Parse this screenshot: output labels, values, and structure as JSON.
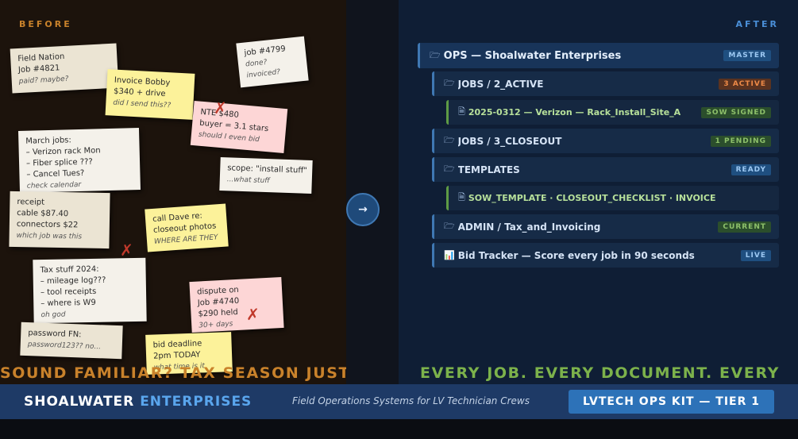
{
  "left": {
    "label": "BEFORE",
    "headline": "SOUND FAMILIAR? TAX SEASON JUST",
    "notes": [
      {
        "lines": [
          "Field Nation",
          "Job #4821"
        ],
        "italic": "paid? maybe?"
      },
      {
        "lines": [
          "Invoice Bobby",
          "$340 + drive"
        ],
        "italic": "did I send this??"
      },
      {
        "lines": [
          "job #4799",
          "done?",
          "invoiced?"
        ],
        "italic": ""
      },
      {
        "lines": [
          "NTE $480",
          "buyer = 3.1 stars"
        ],
        "italic": "should I even bid"
      },
      {
        "lines": [
          "March jobs:",
          "– Verizon rack Mon",
          "– Fiber splice ???",
          "– Cancel Tues?"
        ],
        "italic": "check calendar"
      },
      {
        "lines": [
          "scope: \"install stuff\""
        ],
        "italic": "...what stuff"
      },
      {
        "lines": [
          "receipt",
          "cable $87.40",
          "connectors $22"
        ],
        "italic": "which job was this"
      },
      {
        "lines": [
          "call Dave re:",
          "closeout photos"
        ],
        "italic": "WHERE ARE THEY"
      },
      {
        "lines": [
          "Tax stuff 2024:",
          "– mileage log???",
          "– tool receipts",
          "– where is W9"
        ],
        "italic": "oh god"
      },
      {
        "lines": [
          "dispute on",
          "Job #4740",
          "$290 held"
        ],
        "italic": "30+ days"
      },
      {
        "lines": [
          "password FN:"
        ],
        "italic": "password123?? no..."
      },
      {
        "lines": [
          "bid deadline",
          "2pm TODAY"
        ],
        "italic": "what time is it"
      }
    ],
    "x_mark": "✗"
  },
  "arrow": "→",
  "right": {
    "label": "AFTER",
    "headline": "EVERY JOB. EVERY DOCUMENT. EVERY",
    "rows": [
      {
        "icon": "🗁",
        "label": "OPS — Shoalwater Enterprises",
        "badge": "MASTER"
      },
      {
        "icon": "🗁",
        "label": "JOBS / 2_ACTIVE",
        "badge": "3 ACTIVE"
      },
      {
        "icon": "🗎",
        "label": "2025-0312 — Verizon — Rack_Install_Site_A",
        "badge": "SOW SIGNED"
      },
      {
        "icon": "🗁",
        "label": "JOBS / 3_CLOSEOUT",
        "badge": "1 PENDING"
      },
      {
        "icon": "🗁",
        "label": "TEMPLATES",
        "badge": "READY"
      },
      {
        "icon": "🗎",
        "label": "SOW_TEMPLATE · CLOSEOUT_CHECKLIST · INVOICE",
        "badge": ""
      },
      {
        "icon": "🗁",
        "label": "ADMIN / Tax_and_Invoicing",
        "badge": "CURRENT"
      },
      {
        "icon": "📊",
        "label": "Bid Tracker — Score every job in 90 seconds",
        "badge": "LIVE"
      }
    ]
  },
  "footer": {
    "brand_main": "SHOALWATER",
    "brand_accent": "ENTERPRISES",
    "tagline": "Field Operations Systems for LV Technician Crews",
    "cta": "LVTECH OPS KIT — TIER 1"
  },
  "colors": {
    "before_accent": "#c9822b",
    "after_accent": "#4a8fd8",
    "after_headline": "#7cb24b",
    "status_orange": "#ee8a47",
    "status_green": "#8dc06a"
  }
}
